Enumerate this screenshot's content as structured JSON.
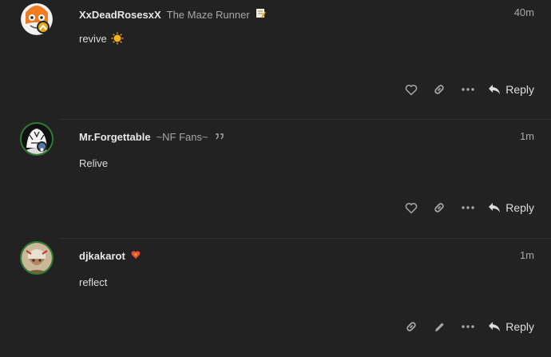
{
  "posts": [
    {
      "username": "XxDeadRosesxX",
      "user_title": "The Maze Runner",
      "title_icon": "memo-emoji-icon",
      "time": "40m",
      "body": "revive",
      "body_icon": "sun-emoji-icon",
      "actions": [
        "like-icon",
        "link-icon",
        "more-icon"
      ],
      "reply_label": "Reply"
    },
    {
      "username": "Mr.Forgettable",
      "user_title": "~NF Fans~",
      "title_icon": "quotes-icon",
      "time": "1m",
      "body": "Relive",
      "actions": [
        "like-icon",
        "link-icon",
        "more-icon"
      ],
      "reply_label": "Reply"
    },
    {
      "username": "djkakarot",
      "user_title": "",
      "title_icon": "heart-status-emoji-icon",
      "time": "1m",
      "body": "reflect",
      "actions": [
        "link-icon",
        "edit-icon",
        "more-icon"
      ],
      "reply_label": "Reply"
    }
  ],
  "colors": {
    "background": "#222222",
    "divider": "#333333",
    "username": "#e8e8e8",
    "muted": "#a8a8a8",
    "avatar_border_green": "#2e7d32",
    "flair_gold": "#e6a817"
  }
}
